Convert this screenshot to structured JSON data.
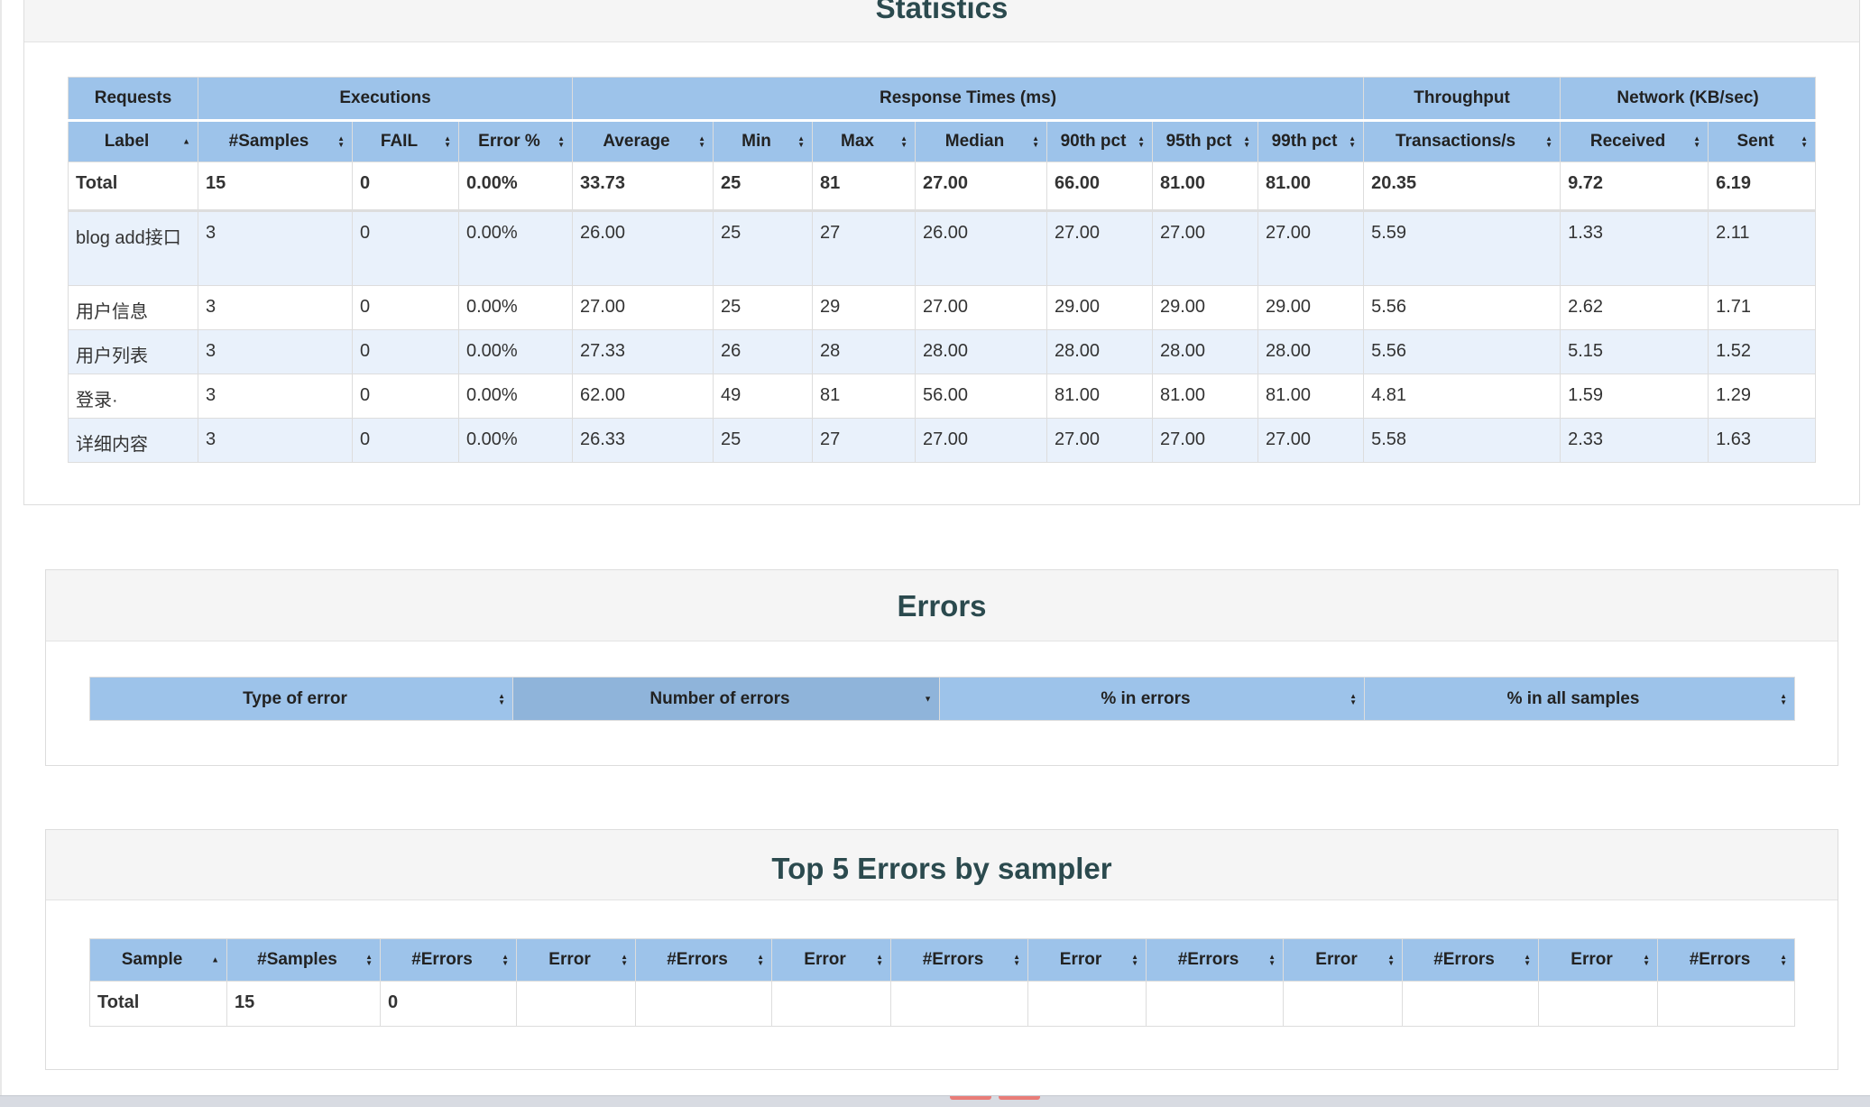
{
  "statistics": {
    "title": "Statistics",
    "group_headers": [
      "Requests",
      "Executions",
      "Response Times (ms)",
      "Throughput",
      "Network (KB/sec)"
    ],
    "columns": [
      "Label",
      "#Samples",
      "FAIL",
      "Error %",
      "Average",
      "Min",
      "Max",
      "Median",
      "90th pct",
      "95th pct",
      "99th pct",
      "Transactions/s",
      "Received",
      "Sent"
    ],
    "total": [
      "Total",
      "15",
      "0",
      "0.00%",
      "33.73",
      "25",
      "81",
      "27.00",
      "66.00",
      "81.00",
      "81.00",
      "20.35",
      "9.72",
      "6.19"
    ],
    "rows": [
      [
        "blog add接口",
        "3",
        "0",
        "0.00%",
        "26.00",
        "25",
        "27",
        "26.00",
        "27.00",
        "27.00",
        "27.00",
        "5.59",
        "1.33",
        "2.11"
      ],
      [
        "用户信息",
        "3",
        "0",
        "0.00%",
        "27.00",
        "25",
        "29",
        "27.00",
        "29.00",
        "29.00",
        "29.00",
        "5.56",
        "2.62",
        "1.71"
      ],
      [
        "用户列表",
        "3",
        "0",
        "0.00%",
        "27.33",
        "26",
        "28",
        "28.00",
        "28.00",
        "28.00",
        "28.00",
        "5.56",
        "5.15",
        "1.52"
      ],
      [
        "登录·",
        "3",
        "0",
        "0.00%",
        "62.00",
        "49",
        "81",
        "56.00",
        "81.00",
        "81.00",
        "81.00",
        "4.81",
        "1.59",
        "1.29"
      ],
      [
        "详细内容",
        "3",
        "0",
        "0.00%",
        "26.33",
        "25",
        "27",
        "27.00",
        "27.00",
        "27.00",
        "27.00",
        "5.58",
        "2.33",
        "1.63"
      ]
    ]
  },
  "errors": {
    "title": "Errors",
    "columns": [
      "Type of error",
      "Number of errors",
      "% in errors",
      "% in all samples"
    ]
  },
  "top5": {
    "title": "Top 5 Errors by sampler",
    "columns": [
      "Sample",
      "#Samples",
      "#Errors",
      "Error",
      "#Errors",
      "Error",
      "#Errors",
      "Error",
      "#Errors",
      "Error",
      "#Errors",
      "Error",
      "#Errors"
    ],
    "total": [
      "Total",
      "15",
      "0",
      "",
      "",
      "",
      "",
      "",
      "",
      "",
      "",
      "",
      ""
    ]
  },
  "colors": {
    "header_bg": "#9dc3ea",
    "header_active_bg": "#8fb4da",
    "alt_row_bg": "#e9f1fb",
    "title_color": "#2b4a4e"
  }
}
